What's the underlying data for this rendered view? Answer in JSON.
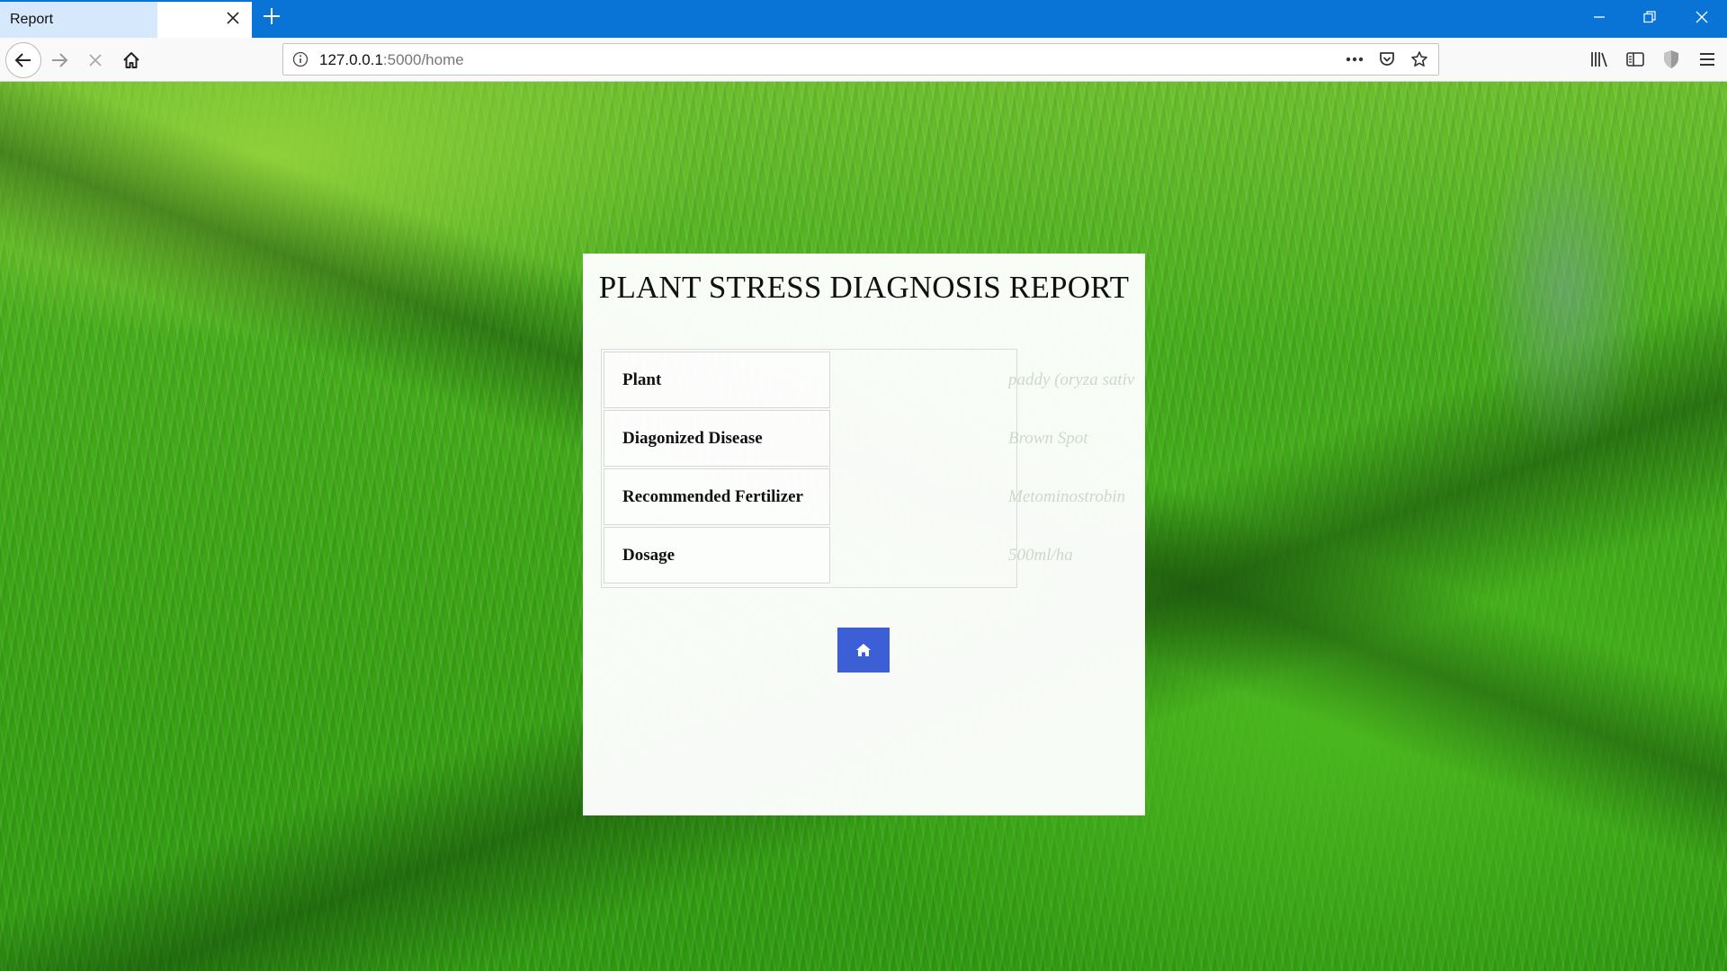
{
  "browser": {
    "tab_title": "Report",
    "url_host": "127.0.0.1",
    "url_rest": ":5000/home"
  },
  "report": {
    "title": "PLANT STRESS DIAGNOSIS REPORT",
    "rows": [
      {
        "label": "Plant",
        "value": "paddy (oryza sativ"
      },
      {
        "label": "Diagonized Disease",
        "value": "Brown Spot"
      },
      {
        "label": "Recommended Fertilizer",
        "value": "Metominostrobin"
      },
      {
        "label": "Dosage",
        "value": "500ml/ha"
      }
    ]
  },
  "colors": {
    "tabbar": "#0a74d6",
    "home_button": "#3d5fd6"
  },
  "icons": {
    "home_button": "home-icon"
  }
}
